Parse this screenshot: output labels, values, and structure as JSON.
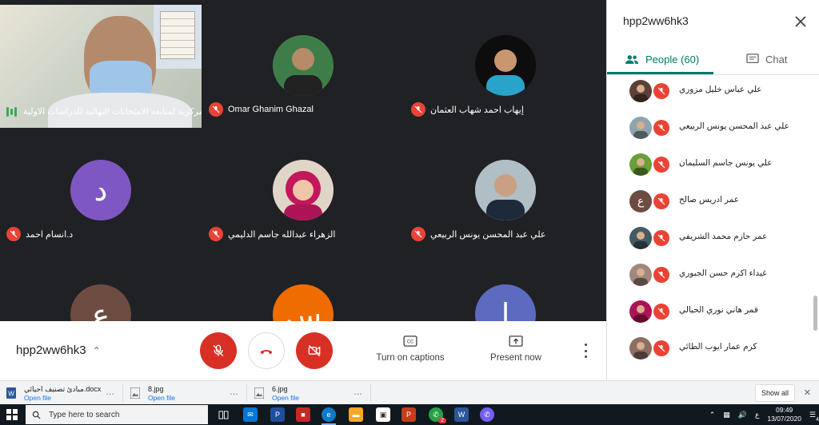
{
  "tiles": [
    {
      "name": "اللجنة المركزية لمتابعة الامتحانات النهائية للدراسات الاولية",
      "kind": "presenter"
    },
    {
      "name": "Omar Ghanim Ghazal",
      "kind": "photo",
      "color": "#2f5d3a"
    },
    {
      "name": "إيهاب احمد شهاب العثمان",
      "kind": "photo",
      "color": "#1a1a1a"
    },
    {
      "name": "د.انسام احمد",
      "kind": "letter",
      "letter": "د",
      "color": "#7e57c2"
    },
    {
      "name": "الزهراء عبدالله جاسم الدليمي",
      "kind": "photo",
      "color": "#c2185b"
    },
    {
      "name": "علي عبد المحسن يونس الربيعي",
      "kind": "photo",
      "color": "#cfd8dc"
    },
    {
      "name": "",
      "kind": "letter",
      "letter": "ع",
      "color": "#6d4c41"
    },
    {
      "name": "",
      "kind": "letter",
      "letter": "س",
      "color": "#ef6c00"
    },
    {
      "name": "",
      "kind": "letter",
      "letter": "ا",
      "color": "#5c6bc0"
    }
  ],
  "bottombar": {
    "meeting_code": "hpp2ww6hk3",
    "captions_label": "Turn on captions",
    "present_label": "Present now"
  },
  "panel": {
    "title": "hpp2ww6hk3",
    "people_tab": "People (60)",
    "chat_tab": "Chat",
    "people": [
      {
        "name": "علي عباس خليل مزوري",
        "avatar": "photo",
        "color": "#5d4037"
      },
      {
        "name": "علي عبد المحسن يونس الربيعي",
        "avatar": "photo",
        "color": "#90a4ae"
      },
      {
        "name": "علي يونس جاسم السليمان",
        "avatar": "photo",
        "color": "#689f38"
      },
      {
        "name": "عمر ادريس صالح",
        "avatar": "letter",
        "letter": "ع",
        "color": "#6d4c41"
      },
      {
        "name": "عمر حازم محمد الشريفي",
        "avatar": "photo",
        "color": "#455a64"
      },
      {
        "name": "غيداء اكرم حسن الجبوري",
        "avatar": "photo",
        "color": "#a1887f"
      },
      {
        "name": "قمر هاني نوري الحيالي",
        "avatar": "photo",
        "color": "#ad1457"
      },
      {
        "name": "كرم عمار ايوب الطائي",
        "avatar": "photo",
        "color": "#8d6e63"
      }
    ]
  },
  "downloads": {
    "items": [
      {
        "name": "مبادئ تصنيف احيائي.docx",
        "sub": "Open file",
        "icon": "word-doc-icon"
      },
      {
        "name": "8.jpg",
        "sub": "Open file",
        "icon": "image-file-icon"
      },
      {
        "name": "6.jpg",
        "sub": "Open file",
        "icon": "image-file-icon"
      }
    ],
    "show_all": "Show all"
  },
  "taskbar": {
    "search_placeholder": "Type here to search",
    "time": "09:49",
    "date": "13/07/2020",
    "lang": "ع",
    "notif_count": "4",
    "badge": "2"
  },
  "colors": {
    "accent": "#00796b",
    "danger": "#ea4335"
  }
}
